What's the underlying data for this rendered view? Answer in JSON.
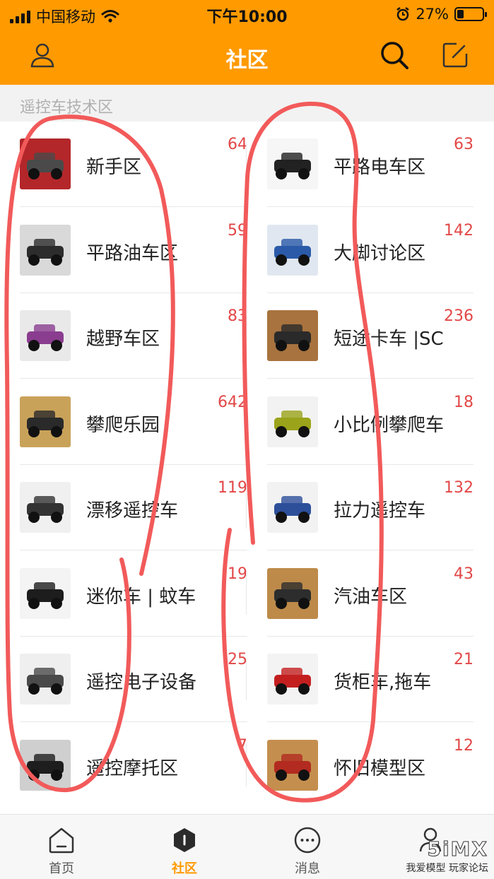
{
  "status": {
    "carrier": "中国移动",
    "time": "下午10:00",
    "battery": "27%",
    "battery_level": 0.27
  },
  "header": {
    "title": "社区",
    "profile_icon": "user-icon",
    "search_icon": "search-icon",
    "compose_icon": "edit-icon"
  },
  "section": {
    "label": "遥控车技术区"
  },
  "forums": {
    "left": [
      {
        "name": "新手区",
        "count": "64"
      },
      {
        "name": "平路油车区",
        "count": "59"
      },
      {
        "name": "越野车区",
        "count": "83"
      },
      {
        "name": "攀爬乐园",
        "count": "642"
      },
      {
        "name": "漂移遥控车",
        "count": "119"
      },
      {
        "name": "迷你车 | 蚊车",
        "count": "19"
      },
      {
        "name": "遥控电子设备",
        "count": "25"
      },
      {
        "name": "遥控摩托区",
        "count": "7"
      }
    ],
    "right": [
      {
        "name": "平路电车区",
        "count": "63"
      },
      {
        "name": "大脚讨论区",
        "count": "142"
      },
      {
        "name": "短途卡车 |SC",
        "count": "236"
      },
      {
        "name": "小比例攀爬车",
        "count": "18"
      },
      {
        "name": "拉力遥控车",
        "count": "132"
      },
      {
        "name": "汽油车区",
        "count": "43"
      },
      {
        "name": "货柜车,拖车",
        "count": "21"
      },
      {
        "name": "怀旧模型区",
        "count": "12"
      }
    ]
  },
  "tabs": [
    {
      "label": "首页",
      "icon": "home-icon"
    },
    {
      "label": "社区",
      "icon": "community-icon"
    },
    {
      "label": "消息",
      "icon": "message-icon"
    },
    {
      "label": "",
      "icon": "profile-icon"
    }
  ],
  "watermark": {
    "line1": "5iMX",
    "line2": "我爱模型 玩家论坛"
  },
  "colors": {
    "accent": "#ff9a00",
    "count": "#e24747",
    "annotation": "#f25a5a"
  }
}
